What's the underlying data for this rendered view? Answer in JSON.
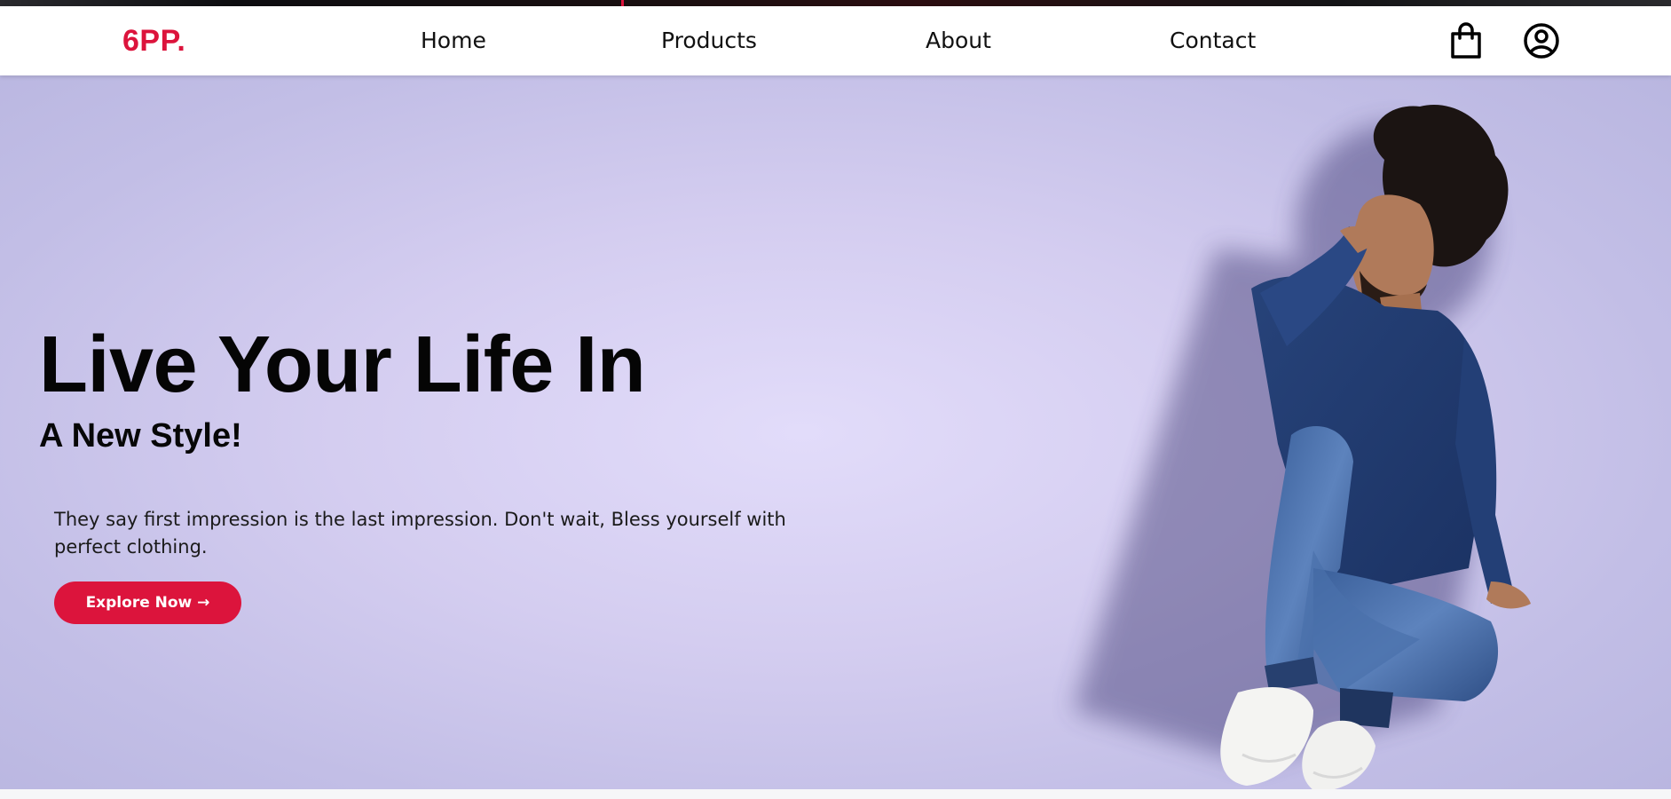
{
  "brand": {
    "logo": "6PP.",
    "accent_color": "#dc143c"
  },
  "nav": {
    "items": [
      {
        "label": "Home"
      },
      {
        "label": "Products"
      },
      {
        "label": "About"
      },
      {
        "label": "Contact"
      }
    ],
    "icons": [
      "shopping-bag-icon",
      "user-account-icon"
    ]
  },
  "hero": {
    "headline": "Live Your Life In",
    "subheadline": "A New Style!",
    "description": "They say first impression is the last impression. Don't wait, Bless yourself with perfect clothing.",
    "cta_label": "Explore Now →",
    "background_color": "#d4cdf0"
  }
}
